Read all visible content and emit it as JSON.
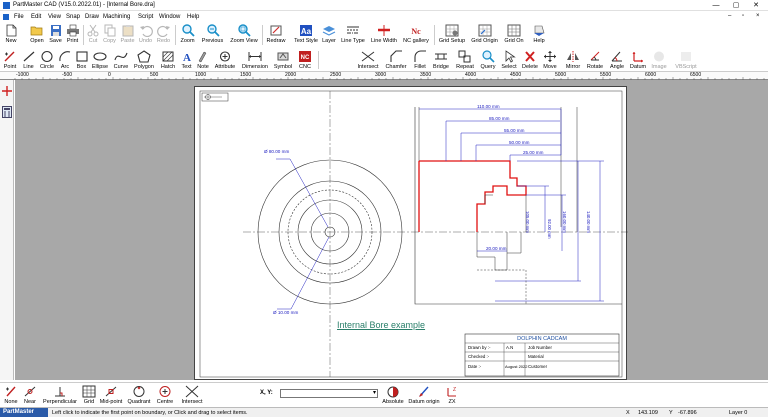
{
  "window": {
    "title": "PartMaster CAD (V15.0.2022.01) - [Internal Bore.dra]",
    "minimize": "—",
    "maximize": "▢",
    "close": "✕"
  },
  "menu": [
    "File",
    "Edit",
    "View",
    "Snap",
    "Draw",
    "Machining",
    "Script",
    "Window",
    "Help"
  ],
  "toolbar1": [
    "New",
    "Open",
    "Save",
    "Print",
    "Cut",
    "Copy",
    "Paste",
    "Undo",
    "Redo",
    "Zoom",
    "Previous",
    "Zoom View",
    "Redraw",
    "Text Style",
    "Layer",
    "Line Type",
    "Line Width",
    "NC gallery",
    "Grid Setup",
    "Grid Origin",
    "Grid On",
    "Help"
  ],
  "toolbar2": [
    "Point",
    "Line",
    "Circle",
    "Arc",
    "Box",
    "Ellipse",
    "Curve",
    "Polygon",
    "Hatch",
    "Text",
    "Note",
    "Attribute",
    "Dimension",
    "Symbol",
    "CNC",
    "Intersect",
    "Chamfer",
    "Fillet",
    "Bridge",
    "Repeat",
    "Query",
    "Select",
    "Delete",
    "Move",
    "Mirror",
    "Rotate",
    "Angle",
    "Datum",
    "Image",
    "VBScript"
  ],
  "ruler": [
    "-1000",
    "-500",
    "0",
    "500",
    "1000",
    "1500",
    "2000",
    "2500",
    "3000",
    "3500",
    "4000",
    "4500",
    "5000",
    "5500",
    "6000",
    "6500"
  ],
  "drawing": {
    "dim_dia_large": "Ø 80.00 mm",
    "dim_dia_small": "Ø 10.00 mm",
    "dims_top": [
      "110.00 mm",
      "85.00 mm",
      "55.00 mm",
      "50.00 mm",
      "25.00 mm"
    ],
    "dims_side": [
      "105.00 mm",
      "160.00 mm",
      "140.00 mm",
      "92.00 mm"
    ],
    "dim_bottom": "20.00 mm",
    "title": "Internal Bore example",
    "titleblock": {
      "company": "DOLPHIN CADCAM",
      "drawn_label": "Drawn by :-",
      "drawn_value": "A.N",
      "jobno_label": "Job Number",
      "checked_label": "Checked :-",
      "material_label": "Material",
      "date_label": "Date :-",
      "date_value": "August 2022",
      "customer_label": "Customer"
    }
  },
  "snap": [
    "None",
    "Near",
    "Perpendicular",
    "Grid",
    "Mid-point",
    "Quadrant",
    "Centre",
    "Intersect"
  ],
  "coords_label": "X, Y:",
  "datum": [
    "Absolute",
    "Datum origin",
    "ZX"
  ],
  "status": {
    "brand": "PartMaster",
    "message": "Left click to indicate the first point on boundary, or Click and drag to select items.",
    "x_label": "X",
    "x_value": "143.109",
    "y_label": "Y",
    "y_value": "-67.896",
    "layer": "Layer 0"
  },
  "colors": {
    "accent": "#1a62c8",
    "dimension": "#2020c0",
    "profile": "#e01010"
  }
}
